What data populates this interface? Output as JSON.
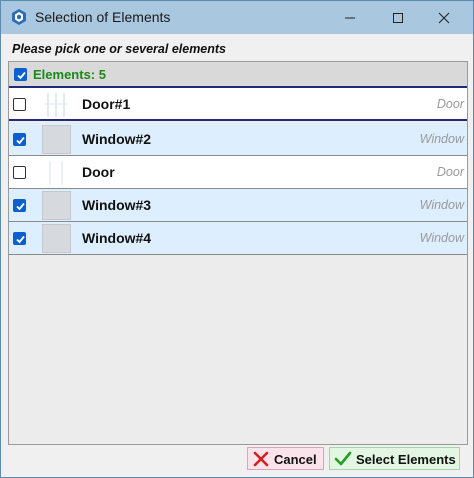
{
  "window": {
    "title": "Selection of Elements"
  },
  "prompt": "Please pick one or several elements",
  "list": {
    "header_label": "Elements: 5",
    "header_checked": true,
    "rows": [
      {
        "name": "Door#1",
        "type": "Door",
        "checked": false,
        "thumb": "door"
      },
      {
        "name": "Window#2",
        "type": "Window",
        "checked": true,
        "thumb": "window"
      },
      {
        "name": "Door",
        "type": "Door",
        "checked": false,
        "thumb": "door"
      },
      {
        "name": "Window#3",
        "type": "Window",
        "checked": true,
        "thumb": "window"
      },
      {
        "name": "Window#4",
        "type": "Window",
        "checked": true,
        "thumb": "window"
      }
    ]
  },
  "buttons": {
    "cancel_label": "Cancel",
    "select_label": "Select Elements"
  },
  "colors": {
    "titlebar": "#a9c8e0",
    "selected_row": "#ddeeff",
    "header_text": "#1a8a1a",
    "checkbox_on": "#0b5fd1"
  },
  "icons": {
    "app": "app-logo-icon",
    "cancel": "red-x-icon",
    "select": "green-check-icon"
  }
}
